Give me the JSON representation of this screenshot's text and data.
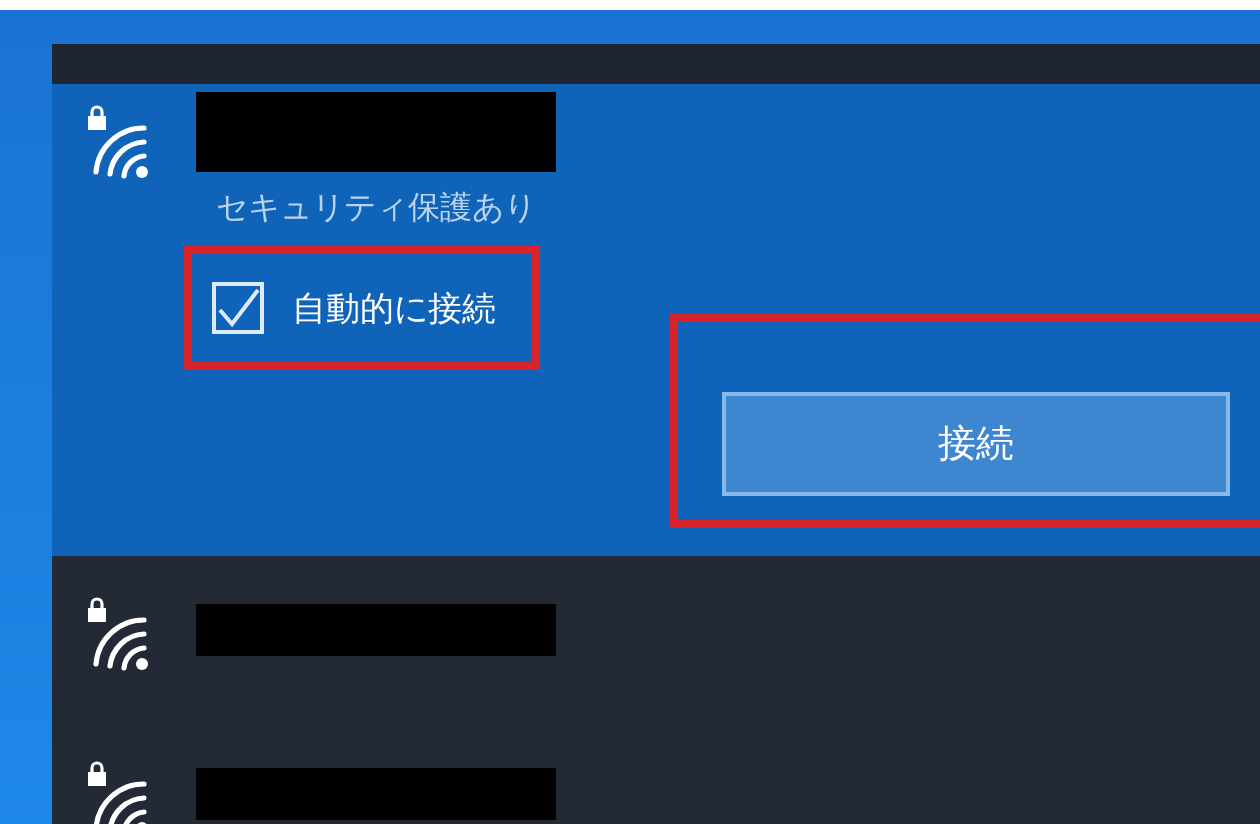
{
  "networks": [
    {
      "selected": true,
      "secured": true,
      "security": "セキュリティ保護あり",
      "auto_connect": {
        "label": "自動的に接続",
        "checked": true,
        "highlighted": true
      },
      "connect_button": {
        "label": "接続",
        "highlighted": true
      }
    },
    {
      "selected": false,
      "secured": true
    },
    {
      "selected": false,
      "secured": true
    }
  ]
}
